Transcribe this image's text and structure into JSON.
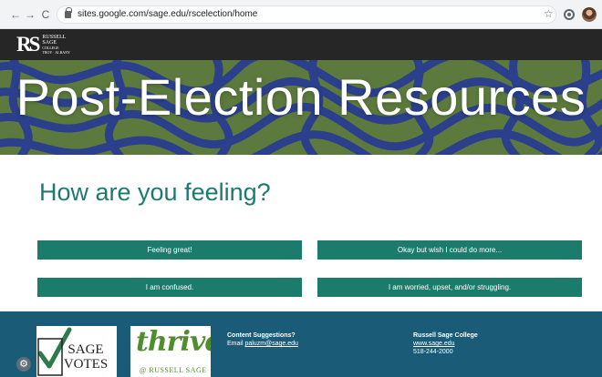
{
  "browser": {
    "url": "sites.google.com/sage.edu/rscelection/home",
    "back_glyph": "←",
    "forward_glyph": "→",
    "reload_glyph": "C",
    "star_glyph": "☆"
  },
  "header": {
    "logo_mark": "RS",
    "logo_lines": [
      "RUSSELL",
      "SAGE",
      "COLLEGE"
    ],
    "logo_tagline": "TROY · ALBANY"
  },
  "hero": {
    "title": "Post-Election Resources"
  },
  "main": {
    "question": "How are you feeling?",
    "choices": [
      "Feeling great!",
      "Okay but wish I could do more...",
      "I am confused.",
      "I am worried, upset, and/or struggling."
    ]
  },
  "footer": {
    "sage_votes": [
      "SAGE",
      "VOTES"
    ],
    "thrive_word": "thrive",
    "thrive_sub": "@ RUSSELL SAGE",
    "content_heading": "Content Suggestions?",
    "email_label": "Email ",
    "email": "paluzm@sage.edu",
    "college_name": "Russell Sage College",
    "website": "www.sage.edu",
    "phone": "518-244-2000",
    "settings_glyph": "⚙"
  },
  "colors": {
    "hero_green": "#5c7a3d",
    "hero_blue": "#2b3f8c",
    "button_teal": "#1c7c6b",
    "question_teal": "#1d7a70",
    "footer_blue": "#1a5b78"
  }
}
